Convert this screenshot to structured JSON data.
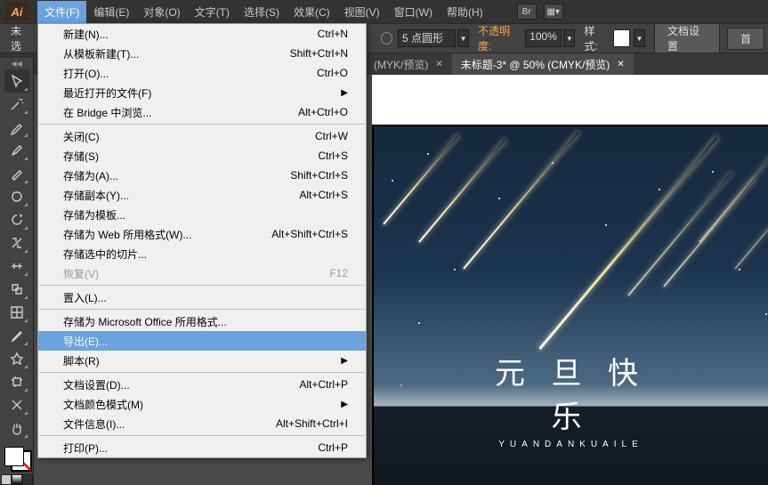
{
  "app_logo_text": "Ai",
  "menubar": {
    "items": [
      "文件(F)",
      "编辑(E)",
      "对象(O)",
      "文字(T)",
      "选择(S)",
      "效果(C)",
      "视图(V)",
      "窗口(W)",
      "帮助(H)"
    ],
    "br_label": "Br"
  },
  "optbar": {
    "nosel": "未选",
    "stroke_label": "5 点圆形",
    "opacity_label": "不透明度:",
    "opacity_value": "100%",
    "style_label": "样式:",
    "docsetup_btn": "文档设置",
    "prefs_btn": "首"
  },
  "tabs": [
    {
      "label": "(MYK/预览)",
      "active": false
    },
    {
      "label": "未标题-3* @ 50% (CMYK/预览)",
      "active": true
    }
  ],
  "artboard": {
    "title_cn": "元 旦 快 乐",
    "title_en": "YUANDANKUAILE"
  },
  "menu": {
    "groups": [
      [
        {
          "label": "新建(N)...",
          "shortcut": "Ctrl+N"
        },
        {
          "label": "从模板新建(T)...",
          "shortcut": "Shift+Ctrl+N"
        },
        {
          "label": "打开(O)...",
          "shortcut": "Ctrl+O"
        },
        {
          "label": "最近打开的文件(F)",
          "submenu": true
        },
        {
          "label": "在 Bridge 中浏览...",
          "shortcut": "Alt+Ctrl+O"
        }
      ],
      [
        {
          "label": "关闭(C)",
          "shortcut": "Ctrl+W"
        },
        {
          "label": "存储(S)",
          "shortcut": "Ctrl+S"
        },
        {
          "label": "存储为(A)...",
          "shortcut": "Shift+Ctrl+S"
        },
        {
          "label": "存储副本(Y)...",
          "shortcut": "Alt+Ctrl+S"
        },
        {
          "label": "存储为模板..."
        },
        {
          "label": "存储为 Web 所用格式(W)...",
          "shortcut": "Alt+Shift+Ctrl+S"
        },
        {
          "label": "存储选中的切片..."
        },
        {
          "label": "恢复(V)",
          "shortcut": "F12",
          "disabled": true
        }
      ],
      [
        {
          "label": "置入(L)..."
        }
      ],
      [
        {
          "label": "存储为 Microsoft Office 所用格式..."
        },
        {
          "label": "导出(E)...",
          "hover": true
        },
        {
          "label": "脚本(R)",
          "submenu": true
        }
      ],
      [
        {
          "label": "文档设置(D)...",
          "shortcut": "Alt+Ctrl+P"
        },
        {
          "label": "文档颜色模式(M)",
          "submenu": true
        },
        {
          "label": "文件信息(I)...",
          "shortcut": "Alt+Shift+Ctrl+I"
        }
      ],
      [
        {
          "label": "打印(P)...",
          "shortcut": "Ctrl+P"
        }
      ]
    ]
  },
  "tools": [
    "selection",
    "magic-wand",
    "pen",
    "brush",
    "pencil",
    "blob",
    "rotate",
    "scale",
    "width",
    "shape-builder",
    "mesh",
    "eyedropper",
    "symbol",
    "artboard",
    "slice",
    "hand"
  ]
}
